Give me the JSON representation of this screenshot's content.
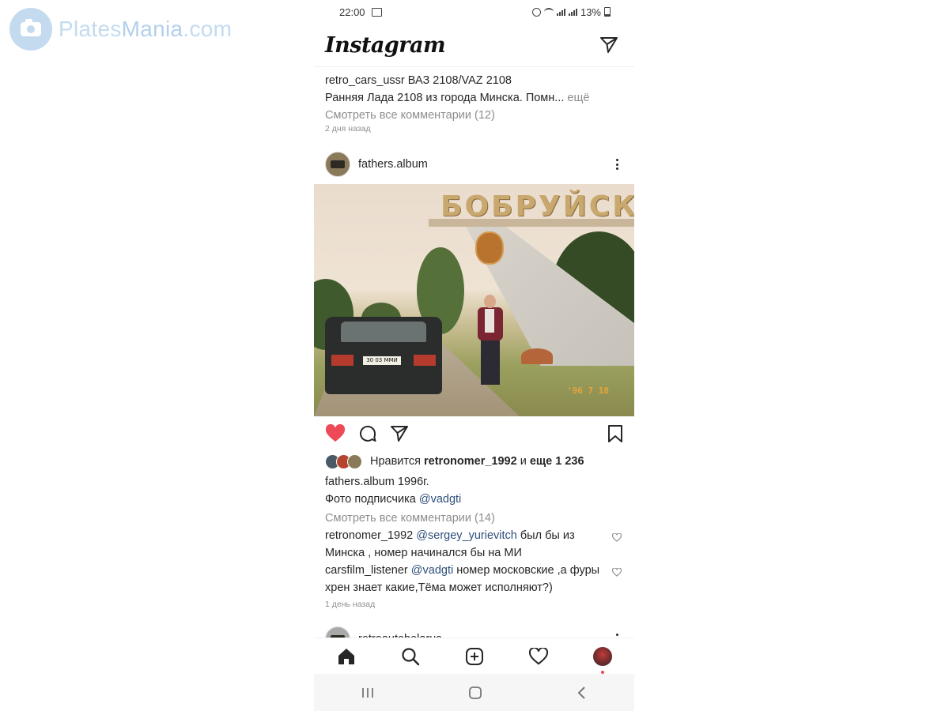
{
  "watermark": {
    "brand_a": "Plates",
    "brand_b": "Mania",
    "brand_c": ".com"
  },
  "status_bar": {
    "time": "22:00",
    "battery": "13%"
  },
  "app": {
    "title": "Instagram"
  },
  "prev_post": {
    "username": "retro_cars_ussr",
    "caption_title": "ВАЗ 2108/VAZ 2108",
    "caption_text": "Ранняя Лада 2108 из города Минска. Помн...",
    "more_label": "ещё",
    "view_comments": "Смотреть все комментарии (12)",
    "time_ago": "2 дня назад"
  },
  "post": {
    "username": "fathers.album",
    "photo": {
      "sign_text": "БОБРУЙСК",
      "plate_text": "30 03 ММИ",
      "date_stamp": "'96  7 18"
    },
    "likes": {
      "prefix": "Нравится",
      "liker": "retronomer_1992",
      "conj": "и",
      "others": "еще 1 236"
    },
    "caption": {
      "username": "fathers.album",
      "text1": "1996г.",
      "text2_prefix": "Фото подписчика",
      "mention": "@vadgti"
    },
    "view_comments": "Смотреть все комментарии (14)",
    "comments": [
      {
        "username": "retronomer_1992",
        "mention": "@sergey_yurievitch",
        "text": "был бы из Минска , номер начинался бы на МИ"
      },
      {
        "username": "carsfilm_listener",
        "mention": "@vadgti",
        "text": "номер московские ,а фуры хрен знает какие,Тёма может исполняют?)"
      }
    ],
    "time_ago": "1 день назад"
  },
  "next_post": {
    "username": "retroautobelarus"
  },
  "colors": {
    "like_red": "#ed4956",
    "link_blue": "#2d4f7a",
    "muted_gray": "#8e8e8e"
  }
}
